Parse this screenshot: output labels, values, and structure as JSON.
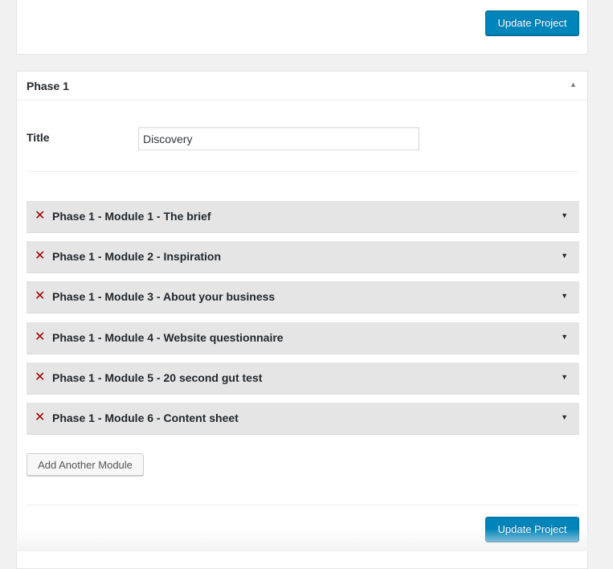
{
  "top_panel": {
    "update_label": "Update Project"
  },
  "phase": {
    "heading": "Phase 1",
    "collapse_icon": "triangle-up-icon",
    "title_label": "Title",
    "title_value": "Discovery",
    "modules": [
      {
        "label": "Phase 1 - Module 1 - The brief"
      },
      {
        "label": "Phase 1 - Module 2 - Inspiration"
      },
      {
        "label": "Phase 1 - Module 3 - About your business"
      },
      {
        "label": "Phase 1 - Module 4 - Website questionnaire"
      },
      {
        "label": "Phase 1 - Module 5 - 20 second gut test"
      },
      {
        "label": "Phase 1 - Module 6 - Content sheet"
      }
    ],
    "add_module_label": "Add Another Module",
    "update_label": "Update Project"
  },
  "icons": {
    "remove": "close-x-icon",
    "expand": "triangle-down-icon"
  },
  "colors": {
    "primary_button": "#0085ba",
    "remove_icon": "#a00000",
    "module_row_bg": "#e5e5e5"
  }
}
